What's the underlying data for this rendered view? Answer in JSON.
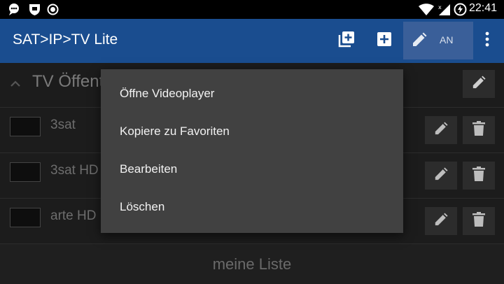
{
  "statusbar": {
    "time": "22:41",
    "left_icons": [
      "chat-notification-icon",
      "shield-notification-icon",
      "record-notification-icon"
    ],
    "right_icons": [
      "wifi-icon",
      "cell-signal-icon",
      "battery-charging-icon"
    ]
  },
  "appbar": {
    "title": "SAT>IP>TV Lite",
    "buttons": [
      "add-multiple-icon",
      "add-box-icon",
      "edit-icon",
      "overflow-menu-icon"
    ],
    "toggle_label": "AN"
  },
  "group": {
    "title": "TV Öffent"
  },
  "channels": [
    {
      "name": "3sat"
    },
    {
      "name": "3sat HD"
    },
    {
      "name": "arte HD"
    }
  ],
  "bottom_bar": {
    "label": "meine Liste"
  },
  "context_menu": {
    "items": [
      {
        "label": "Öffne Videoplayer"
      },
      {
        "label": "Kopiere zu Favoriten"
      },
      {
        "label": "Bearbeiten"
      },
      {
        "label": "Löschen"
      }
    ]
  },
  "colors": {
    "appbar": "#1a4d8f",
    "toggle_active": "#3a5f99",
    "menu_bg": "#414141",
    "background": "#1c1c1c"
  }
}
